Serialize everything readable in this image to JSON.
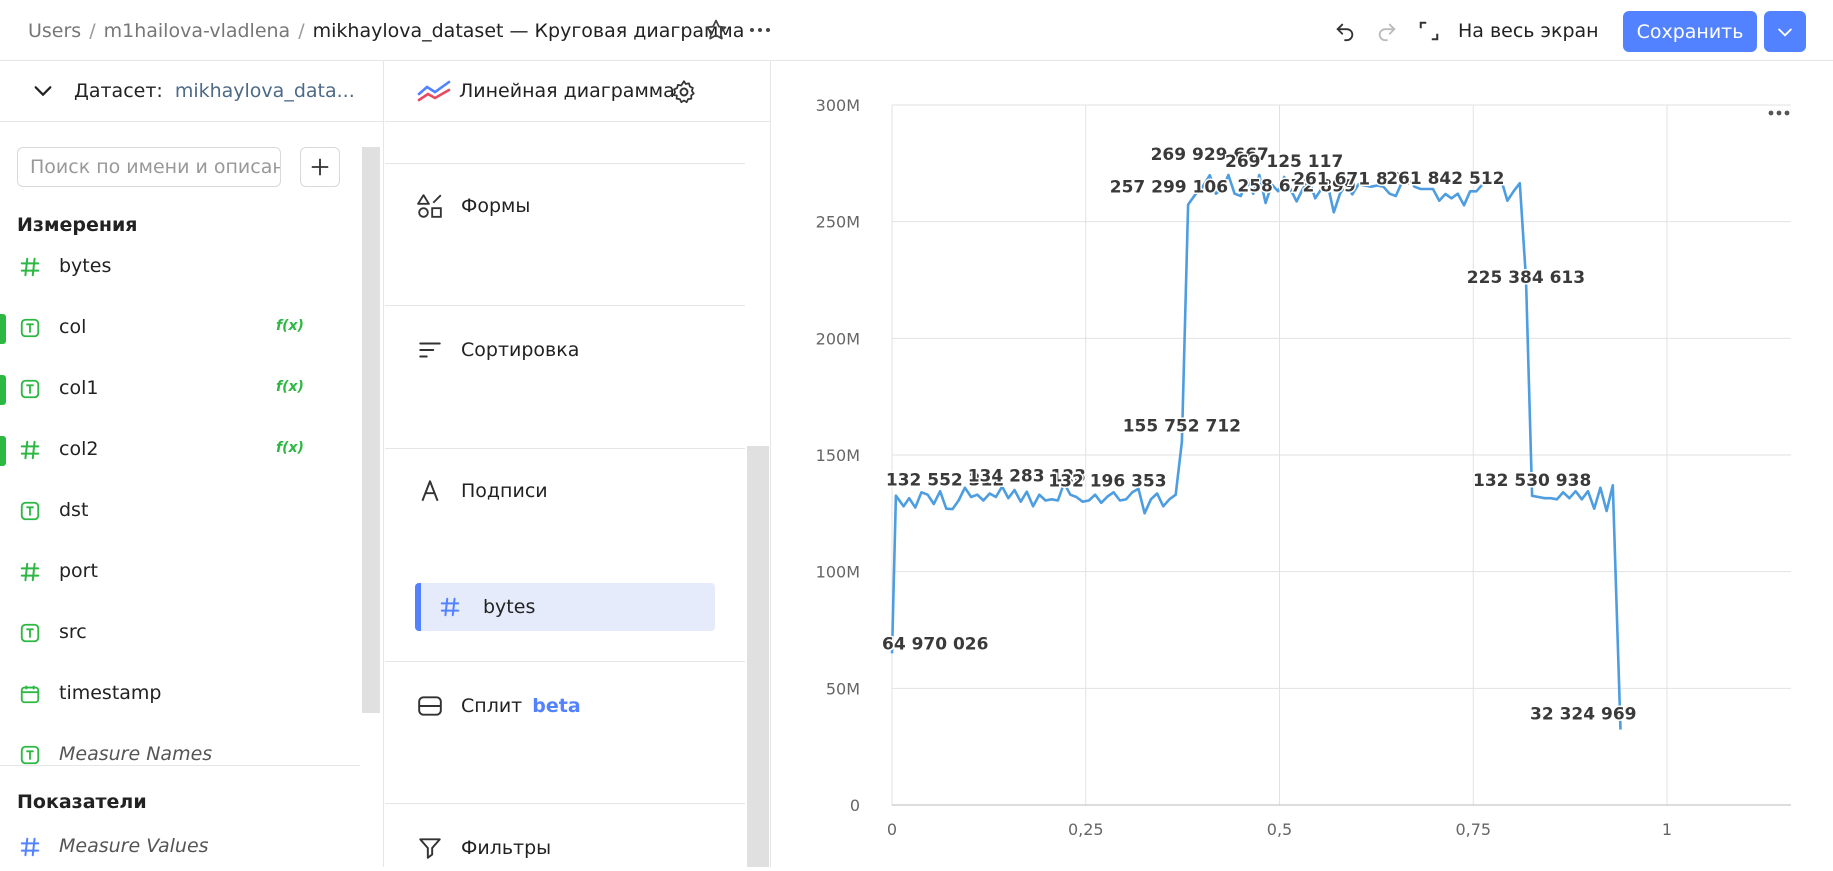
{
  "breadcrumbs": {
    "root": "Users",
    "folder": "m1hailova-vladlena",
    "current": "mikhaylova_dataset — Круговая диаграмма"
  },
  "toolbar": {
    "fullscreen_label": "На весь экран",
    "save_label": "Сохранить"
  },
  "dataset": {
    "label": "Датасет:",
    "value": "mikhaylova_data..."
  },
  "search": {
    "placeholder": "Поиск по имени и описани"
  },
  "dimensions": {
    "title": "Измерения",
    "fields": [
      {
        "name": "bytes",
        "type": "number",
        "fx": false
      },
      {
        "name": "col",
        "type": "text",
        "fx": true
      },
      {
        "name": "col1",
        "type": "text",
        "fx": true
      },
      {
        "name": "col2",
        "type": "number",
        "fx": true
      },
      {
        "name": "dst",
        "type": "text",
        "fx": false
      },
      {
        "name": "port",
        "type": "number",
        "fx": false
      },
      {
        "name": "src",
        "type": "text",
        "fx": false
      },
      {
        "name": "timestamp",
        "type": "date",
        "fx": false
      },
      {
        "name": "Measure Names",
        "type": "text",
        "fx": false
      }
    ]
  },
  "measures": {
    "title": "Показатели",
    "fields": [
      {
        "name": "Measure Values",
        "type": "number"
      }
    ]
  },
  "fx_label": "f(x)",
  "visualization": {
    "type_label": "Линейная диаграмма"
  },
  "sections": {
    "shapes": "Формы",
    "sort": "Сортировка",
    "labels": "Подписи",
    "labels_chip": "bytes",
    "split": "Сплит",
    "split_badge": "beta",
    "filters": "Фильтры"
  },
  "colors": {
    "accent": "#5282ff",
    "line": "#4d9de0",
    "green": "#2db843"
  },
  "chart_data": {
    "type": "line",
    "xlim": [
      0,
      1.16
    ],
    "ylim": [
      0,
      300000000
    ],
    "x_ticks": [
      0,
      0.25,
      0.5,
      0.75,
      1
    ],
    "x_tick_labels": [
      "0",
      "0,25",
      "0,5",
      "0,75",
      "1"
    ],
    "y_ticks": [
      0,
      50000000,
      100000000,
      150000000,
      200000000,
      250000000,
      300000000
    ],
    "y_tick_labels": [
      "0",
      "50M",
      "100M",
      "150M",
      "200M",
      "250M",
      "300M"
    ],
    "grid": true,
    "series": [
      {
        "values": [
          [
            0.0,
            64970026
          ],
          [
            0.005,
            132552312
          ],
          [
            0.015,
            128000000
          ],
          [
            0.022,
            131500000
          ],
          [
            0.03,
            127500000
          ],
          [
            0.038,
            134000000
          ],
          [
            0.046,
            133000000
          ],
          [
            0.054,
            129000000
          ],
          [
            0.062,
            134500000
          ],
          [
            0.07,
            127000000
          ],
          [
            0.078,
            126800000
          ],
          [
            0.086,
            130500000
          ],
          [
            0.094,
            136000000
          ],
          [
            0.102,
            132000000
          ],
          [
            0.11,
            133000000
          ],
          [
            0.118,
            130500000
          ],
          [
            0.126,
            133500000
          ],
          [
            0.134,
            132000000
          ],
          [
            0.142,
            136500000
          ],
          [
            0.15,
            131500000
          ],
          [
            0.158,
            135000000
          ],
          [
            0.166,
            130000000
          ],
          [
            0.174,
            134283123
          ],
          [
            0.182,
            128000000
          ],
          [
            0.19,
            133000000
          ],
          [
            0.198,
            130500000
          ],
          [
            0.206,
            131000000
          ],
          [
            0.214,
            130500000
          ],
          [
            0.222,
            138000000
          ],
          [
            0.23,
            133000000
          ],
          [
            0.238,
            132000000
          ],
          [
            0.246,
            130000000
          ],
          [
            0.254,
            130500000
          ],
          [
            0.262,
            133000000
          ],
          [
            0.27,
            129500000
          ],
          [
            0.278,
            132196353
          ],
          [
            0.286,
            134000000
          ],
          [
            0.294,
            130500000
          ],
          [
            0.302,
            131000000
          ],
          [
            0.31,
            134000000
          ],
          [
            0.318,
            135500000
          ],
          [
            0.326,
            125000000
          ],
          [
            0.334,
            131000000
          ],
          [
            0.342,
            133500000
          ],
          [
            0.35,
            128000000
          ],
          [
            0.358,
            131000000
          ],
          [
            0.366,
            133000000
          ],
          [
            0.374,
            155752712
          ],
          [
            0.382,
            257299106
          ],
          [
            0.392,
            262000000
          ],
          [
            0.4,
            264500000
          ],
          [
            0.41,
            269929667
          ],
          [
            0.418,
            262000000
          ],
          [
            0.426,
            264000000
          ],
          [
            0.434,
            270000000
          ],
          [
            0.442,
            262000000
          ],
          [
            0.45,
            261000000
          ],
          [
            0.458,
            268000000
          ],
          [
            0.466,
            262000000
          ],
          [
            0.474,
            270000000
          ],
          [
            0.482,
            258000000
          ],
          [
            0.49,
            266000000
          ],
          [
            0.498,
            263000000
          ],
          [
            0.506,
            269125117
          ],
          [
            0.514,
            264000000
          ],
          [
            0.522,
            258672899
          ],
          [
            0.53,
            264000000
          ],
          [
            0.538,
            268000000
          ],
          [
            0.546,
            260000000
          ],
          [
            0.554,
            264000000
          ],
          [
            0.562,
            266000000
          ],
          [
            0.57,
            254000000
          ],
          [
            0.578,
            262000000
          ],
          [
            0.586,
            266000000
          ],
          [
            0.594,
            261671874
          ],
          [
            0.602,
            266000000
          ],
          [
            0.61,
            265500000
          ],
          [
            0.618,
            265000000
          ],
          [
            0.626,
            265500000
          ],
          [
            0.634,
            265000000
          ],
          [
            0.642,
            262000000
          ],
          [
            0.65,
            261000000
          ],
          [
            0.658,
            267000000
          ],
          [
            0.666,
            269000000
          ],
          [
            0.674,
            265000000
          ],
          [
            0.682,
            264000000
          ],
          [
            0.69,
            264000000
          ],
          [
            0.698,
            264000000
          ],
          [
            0.706,
            259000000
          ],
          [
            0.714,
            261842512
          ],
          [
            0.722,
            260000000
          ],
          [
            0.73,
            262000000
          ],
          [
            0.738,
            257000000
          ],
          [
            0.746,
            263000000
          ],
          [
            0.754,
            263000000
          ],
          [
            0.762,
            266000000
          ],
          [
            0.77,
            266500000
          ],
          [
            0.778,
            267000000
          ],
          [
            0.786,
            268000000
          ],
          [
            0.794,
            259000000
          ],
          [
            0.802,
            263000000
          ],
          [
            0.81,
            266500000
          ],
          [
            0.818,
            225384613
          ],
          [
            0.826,
            132530938
          ],
          [
            0.834,
            132000000
          ],
          [
            0.842,
            131500000
          ],
          [
            0.85,
            131500000
          ],
          [
            0.858,
            131000000
          ],
          [
            0.866,
            134000000
          ],
          [
            0.874,
            131500000
          ],
          [
            0.882,
            134500000
          ],
          [
            0.89,
            131000000
          ],
          [
            0.898,
            134500000
          ],
          [
            0.906,
            127000000
          ],
          [
            0.914,
            136000000
          ],
          [
            0.922,
            126000000
          ],
          [
            0.93,
            137000000
          ],
          [
            0.94,
            32324969
          ]
        ]
      }
    ],
    "data_labels": [
      {
        "x": 0.0,
        "y": 64970026,
        "text": "64 970 026"
      },
      {
        "x": 0.005,
        "y": 132552312,
        "text": "132 552 312"
      },
      {
        "x": 0.174,
        "y": 134283123,
        "text": "134 283 123"
      },
      {
        "x": 0.278,
        "y": 132196353,
        "text": "132 196 353"
      },
      {
        "x": 0.374,
        "y": 155752712,
        "text": "155 752 712"
      },
      {
        "x": 0.382,
        "y": 257299106,
        "text": "257 299 106"
      },
      {
        "x": 0.41,
        "y": 269929667,
        "text": "269 929 667"
      },
      {
        "x": 0.506,
        "y": 269125117,
        "text": "269 125 117"
      },
      {
        "x": 0.522,
        "y": 258672899,
        "text": "258 672 899"
      },
      {
        "x": 0.594,
        "y": 261671874,
        "text": "261 671 874"
      },
      {
        "x": 0.714,
        "y": 261842512,
        "text": "261 842 512"
      },
      {
        "x": 0.818,
        "y": 225384613,
        "text": "225 384 613"
      },
      {
        "x": 0.826,
        "y": 132530938,
        "text": "132 530 938"
      },
      {
        "x": 0.94,
        "y": 32324969,
        "text": "32 324 969"
      }
    ]
  }
}
